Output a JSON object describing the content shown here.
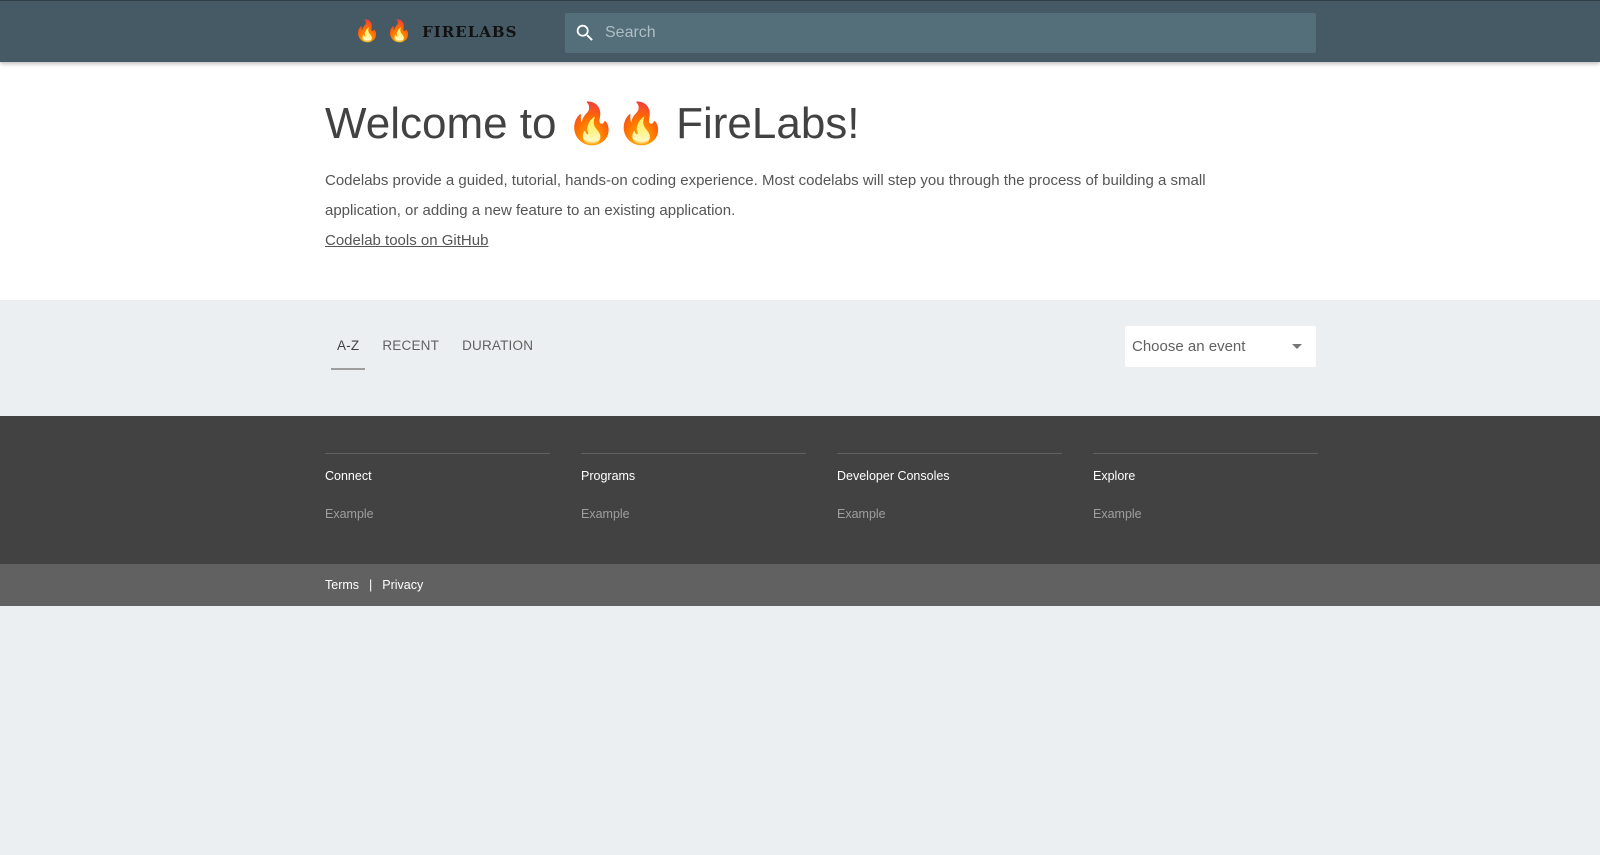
{
  "header": {
    "logo": {
      "flames": "🔥 🔥",
      "wordmark": "FIRELABS"
    },
    "search": {
      "placeholder": "Search",
      "icon": "search-icon"
    },
    "colors": {
      "bar": "#455a64",
      "search_bg": "#546e7a"
    }
  },
  "hero": {
    "title_prefix": "Welcome to",
    "title_flames": "🔥🔥",
    "title_suffix": "FireLabs!",
    "description": "Codelabs provide a guided, tutorial, hands-on coding experience. Most codelabs will step you through the process of building a small application, or adding a new feature to an existing application.",
    "github_link": "Codelab tools on GitHub"
  },
  "filters": {
    "tabs": [
      {
        "label": "A-Z",
        "active": true
      },
      {
        "label": "RECENT",
        "active": false
      },
      {
        "label": "DURATION",
        "active": false
      }
    ],
    "event_select": {
      "selected": "Choose an event",
      "icon": "chevron-down-icon"
    }
  },
  "footer": {
    "columns": [
      {
        "title": "Connect",
        "link": "Example"
      },
      {
        "title": "Programs",
        "link": "Example"
      },
      {
        "title": "Developer Consoles",
        "link": "Example"
      },
      {
        "title": "Explore",
        "link": "Example"
      }
    ],
    "legal": {
      "terms": "Terms",
      "separator": "|",
      "privacy": "Privacy"
    }
  }
}
